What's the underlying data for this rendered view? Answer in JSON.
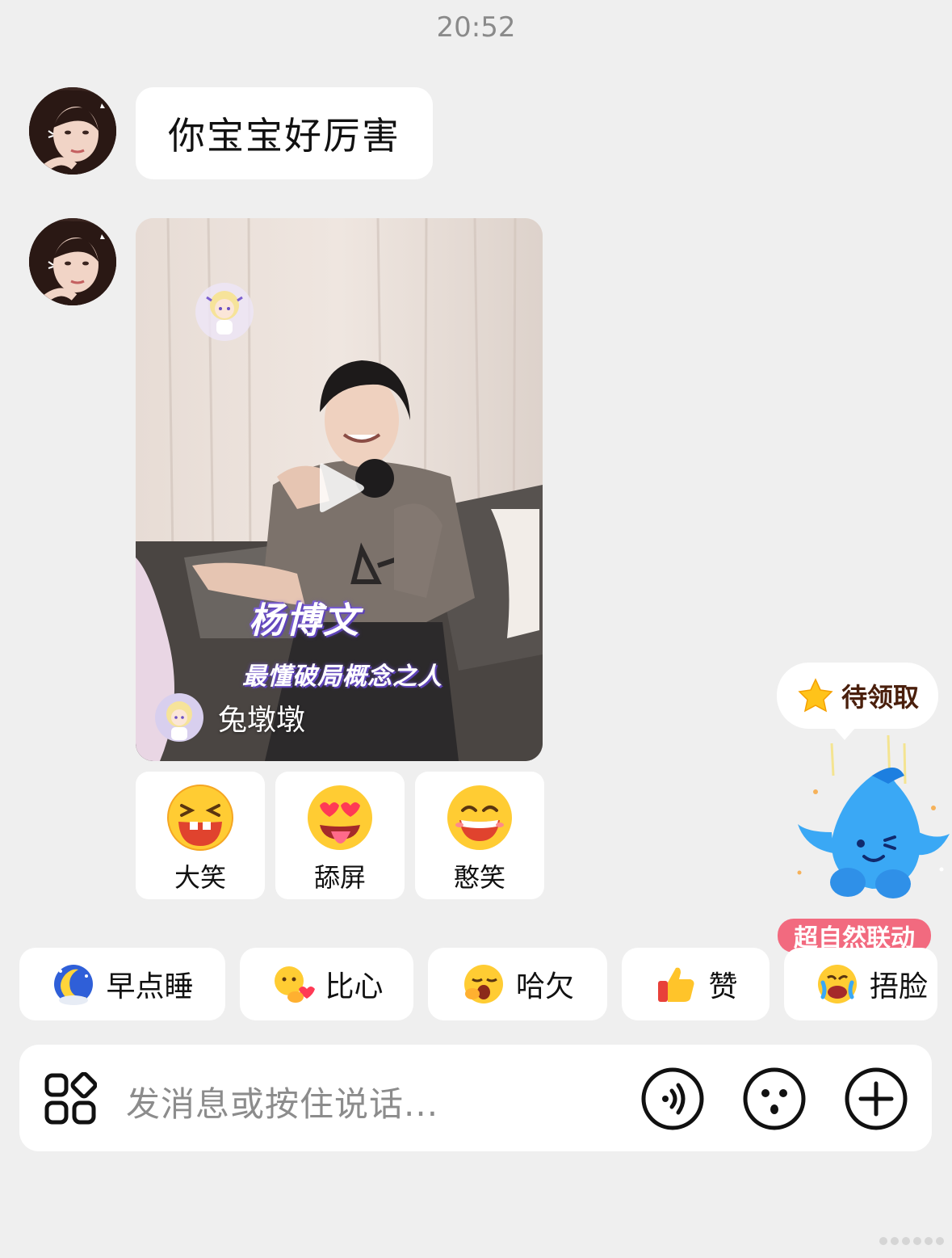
{
  "timestamp": "20:52",
  "messages": [
    {
      "type": "text",
      "text": "你宝宝好厉害"
    },
    {
      "type": "video",
      "title": "杨博文",
      "subtitle": "最懂破局概念之人",
      "author": "兔墩墩"
    }
  ],
  "reactions": [
    {
      "label": "大笑",
      "icon": "laughing-emoji-icon"
    },
    {
      "label": "舔屏",
      "icon": "heart-eyes-tongue-emoji-icon"
    },
    {
      "label": "憨笑",
      "icon": "grin-emoji-icon"
    }
  ],
  "quick_replies": [
    {
      "label": "早点睡",
      "icon": "moon-sleep-icon"
    },
    {
      "label": "比心",
      "icon": "finger-heart-icon"
    },
    {
      "label": "哈欠",
      "icon": "yawn-emoji-icon"
    },
    {
      "label": "赞",
      "icon": "thumbs-up-icon"
    },
    {
      "label": "捂脸",
      "icon": "facepalm-emoji-icon"
    }
  ],
  "promo": {
    "bubble_label": "待领取",
    "tag_label": "超自然联动"
  },
  "input": {
    "placeholder": "发消息或按住说话..."
  },
  "colors": {
    "background": "#efefef",
    "bubble": "#ffffff",
    "promo_tag": "#f26a7f"
  }
}
